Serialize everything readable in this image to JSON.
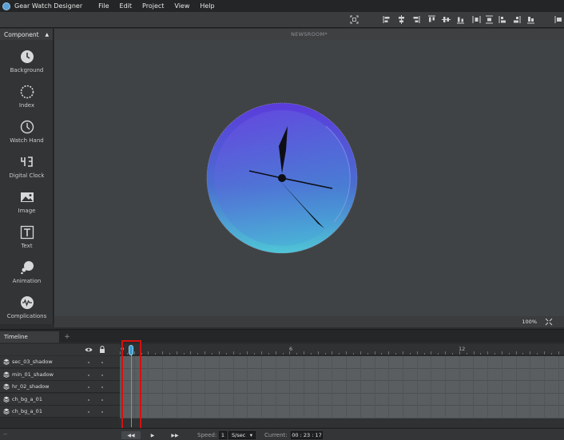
{
  "app": {
    "title": "Gear Watch Designer",
    "menu": [
      "File",
      "Edit",
      "Project",
      "View",
      "Help"
    ]
  },
  "toolbar": {
    "icons": [
      "fit-screen-icon",
      "align-left-icon",
      "align-center-h-icon",
      "align-right-icon",
      "align-top-icon",
      "align-middle-v-icon",
      "align-bottom-icon",
      "distribute-h-icon",
      "distribute-v-icon",
      "distribute-left-icon",
      "distribute-right-icon",
      "distribute-center-icon",
      "more-icon"
    ]
  },
  "component_panel": {
    "title": "Component",
    "items": [
      {
        "label": "Background",
        "icon": "background-icon"
      },
      {
        "label": "Index",
        "icon": "index-icon"
      },
      {
        "label": "Watch Hand",
        "icon": "watch-hand-icon"
      },
      {
        "label": "Digital Clock",
        "icon": "digital-clock-icon"
      },
      {
        "label": "Image",
        "icon": "image-icon"
      },
      {
        "label": "Text",
        "icon": "text-icon"
      },
      {
        "label": "Animation",
        "icon": "animation-icon"
      },
      {
        "label": "Complications",
        "icon": "complications-icon"
      }
    ]
  },
  "canvas": {
    "document_name": "NEWSROOM*",
    "zoom": "100%",
    "colors": {
      "watch_top": "#5a3fd6",
      "watch_bottom": "#4fc4d4"
    }
  },
  "timeline": {
    "tab_label": "Timeline",
    "add_label": "+",
    "ruler_labels": [
      "0",
      "6",
      "12"
    ],
    "layers": [
      {
        "name": "sec_03_shadow"
      },
      {
        "name": "min_01_shadow"
      },
      {
        "name": "hr_02_shadow"
      },
      {
        "name": "ch_bg_a_01"
      },
      {
        "name": "ch_bg_a_01"
      }
    ],
    "playhead_frame": 0,
    "transport": {
      "left_dash": "--",
      "rewind_label": "◀◀",
      "play_label": "▶",
      "forward_label": "▶▶",
      "speed_label": "Speed:",
      "speed_value": "1",
      "speed_unit": "S/sec",
      "current_label": "Current:",
      "current_value": "00 : 23 : 17"
    }
  }
}
